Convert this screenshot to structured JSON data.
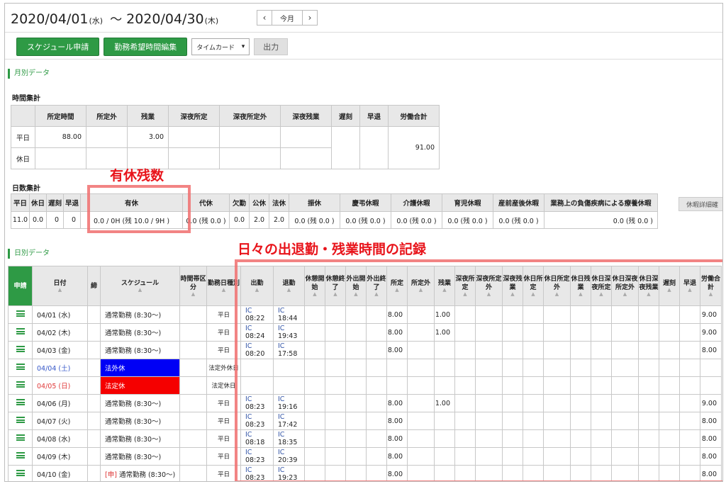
{
  "header": {
    "start_date": "2020/04/01",
    "start_dow": "(水)",
    "tilde": "〜",
    "end_date": "2020/04/30",
    "end_dow": "(木)",
    "prev": "‹",
    "today": "今月",
    "next": "›"
  },
  "toolbar": {
    "schedule_request": "スケジュール申請",
    "edit_hours": "勤務希望時間編集",
    "select_value": "タイムカード",
    "output": "出力"
  },
  "monthly": {
    "section_title": "月別データ",
    "time_title": "時間集計",
    "time_headers": [
      "所定時間",
      "所定外",
      "残業",
      "深夜所定",
      "深夜所定外",
      "深夜残業",
      "遅刻",
      "早退",
      "労働合計"
    ],
    "row_weekday": "平日",
    "row_holiday": "休日",
    "weekday_values": [
      "88.00",
      "",
      "3.00",
      "",
      "",
      ""
    ],
    "total": "91.00",
    "days_title": "日数集計",
    "days_headers": [
      "平日",
      "休日",
      "遅刻",
      "早退",
      "有休",
      "代休",
      "欠勤",
      "公休",
      "法休",
      "振休",
      "慶弔休暇",
      "介護休暇",
      "育児休暇",
      "産前産後休暇",
      "業務上の負傷疾病による療養休暇"
    ],
    "days_values": [
      "11.0",
      "0.0",
      "0",
      "0",
      "0.0 / 0H (残 10.0 / 9H )",
      "0.0 (残 0.0 )",
      "0.0",
      "2.0",
      "2.0",
      "0.0 (残 0.0 )",
      "0.0 (残 0.0 )",
      "0.0 (残 0.0 )",
      "0.0 (残 0.0 )",
      "0.0 (残 0.0 )",
      "0.0 (残 0.0 )"
    ],
    "detail_button": "休暇詳細確"
  },
  "daily": {
    "section_title": "日別データ",
    "headers": [
      "申請",
      "日付",
      "締",
      "スケジュール",
      "時間帯区分",
      "勤務日種別",
      "出勤",
      "退勤",
      "休憩開始",
      "休憩終了",
      "外出開始",
      "外出終了",
      "所定",
      "所定外",
      "残業",
      "深夜所定",
      "深夜所定外",
      "深夜残業",
      "休日所定",
      "休日所定外",
      "休日残業",
      "休日深夜所定",
      "休日深夜所定外",
      "休日深夜残業",
      "遅刻",
      "早退",
      "労働合計"
    ],
    "rows": [
      {
        "date": "04/01 (水)",
        "schedule": "通常勤務 (8:30〜)",
        "type": "平日",
        "in": "08:22",
        "out": "18:44",
        "sched": "8.00",
        "ot": "1.00",
        "total": "9.00"
      },
      {
        "date": "04/02 (木)",
        "schedule": "通常勤務 (8:30〜)",
        "type": "平日",
        "in": "08:24",
        "out": "19:43",
        "sched": "8.00",
        "ot": "1.00",
        "total": "9.00"
      },
      {
        "date": "04/03 (金)",
        "schedule": "通常勤務 (8:30〜)",
        "type": "平日",
        "in": "08:20",
        "out": "17:58",
        "sched": "8.00",
        "ot": "",
        "total": "8.00"
      },
      {
        "date": "04/04 (土)",
        "schedule": "法外休",
        "type": "法定外休日",
        "in": "",
        "out": "",
        "sched": "",
        "ot": "",
        "total": ""
      },
      {
        "date": "04/05 (日)",
        "schedule": "法定休",
        "type": "法定休日",
        "in": "",
        "out": "",
        "sched": "",
        "ot": "",
        "total": ""
      },
      {
        "date": "04/06 (月)",
        "schedule": "通常勤務 (8:30〜)",
        "type": "平日",
        "in": "08:23",
        "out": "19:16",
        "sched": "8.00",
        "ot": "1.00",
        "total": "9.00"
      },
      {
        "date": "04/07 (火)",
        "schedule": "通常勤務 (8:30〜)",
        "type": "平日",
        "in": "08:23",
        "out": "17:42",
        "sched": "8.00",
        "ot": "",
        "total": "8.00"
      },
      {
        "date": "04/08 (水)",
        "schedule": "通常勤務 (8:30〜)",
        "type": "平日",
        "in": "08:18",
        "out": "18:35",
        "sched": "8.00",
        "ot": "",
        "total": "8.00"
      },
      {
        "date": "04/09 (木)",
        "schedule": "通常勤務 (8:30〜)",
        "type": "平日",
        "in": "08:23",
        "out": "20:39",
        "sched": "8.00",
        "ot": "",
        "total": "8.00"
      },
      {
        "date": "04/10 (金)",
        "schedule": "通常勤務 (8:30〜)",
        "request_tag": "[申]",
        "type": "平日",
        "in": "08:23",
        "out": "19:23",
        "sched": "8.00",
        "ot": "",
        "total": "8.00"
      }
    ],
    "ic_label": "IC"
  },
  "annotations": {
    "paid_leave": "有休残数",
    "daily_record": "日々の出退勤・残業時間の記録"
  },
  "colors": {
    "accent": "#2e9a45",
    "annotation": "#e8141b",
    "legal_off": "#0000f5",
    "statutory_off": "#f50000"
  }
}
